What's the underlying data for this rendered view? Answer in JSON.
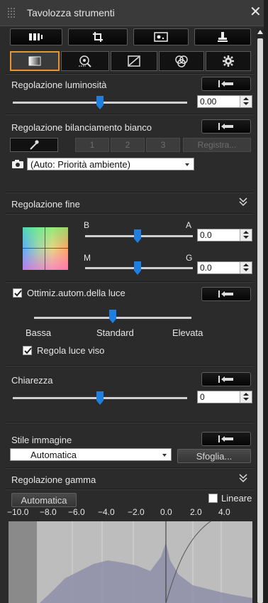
{
  "window": {
    "title": "Tavolozza strumenti"
  },
  "colors": {
    "tab_accent": "#e69532",
    "slider_thumb": "#1f7fe0",
    "panel_bg": "#2b2b2b"
  },
  "toolbar_icons": [
    "film-strip-icon",
    "crop-icon",
    "dust-delete-icon",
    "stamp-icon"
  ],
  "tab_icons": [
    "basic-adjust-icon",
    "lens-correction-icon",
    "tone-curve-icon",
    "color-adjust-icon",
    "settings-gear-icon"
  ],
  "brightness": {
    "label": "Regolazione luminosità",
    "value": "0.00",
    "level": 0.5
  },
  "white_balance": {
    "label": "Regolazione bilanciamento bianco",
    "preset_buttons": [
      "1",
      "2",
      "3"
    ],
    "register_label": "Registra...",
    "mode": "(Auto: Priorità ambiente)"
  },
  "fine_tune": {
    "label": "Regolazione fine",
    "ba": {
      "left": "B",
      "right": "A",
      "value": "0.0",
      "level": 0.5
    },
    "mg": {
      "left": "M",
      "right": "G",
      "value": "0.0",
      "level": 0.5
    }
  },
  "alo": {
    "label": "Ottimiz.autom.della luce",
    "checked": true,
    "scale": [
      "Bassa",
      "Standard",
      "Elevata"
    ],
    "level": 0.5,
    "face_label": "Regola luce viso",
    "face_checked": true
  },
  "clarity": {
    "label": "Chiarezza",
    "value": "0",
    "level": 0.5
  },
  "picture_style": {
    "label": "Stile immagine",
    "value": "Automatica",
    "browse_label": "Sfoglia..."
  },
  "gamma": {
    "label": "Regolazione gamma",
    "auto_label": "Automatica",
    "linear_label": "Lineare",
    "linear_checked": false,
    "ticks": [
      "−10.0",
      "−8.0",
      "−6.0",
      "−4.0",
      "−2.0",
      "0.0",
      "2.0",
      "4.0"
    ]
  }
}
